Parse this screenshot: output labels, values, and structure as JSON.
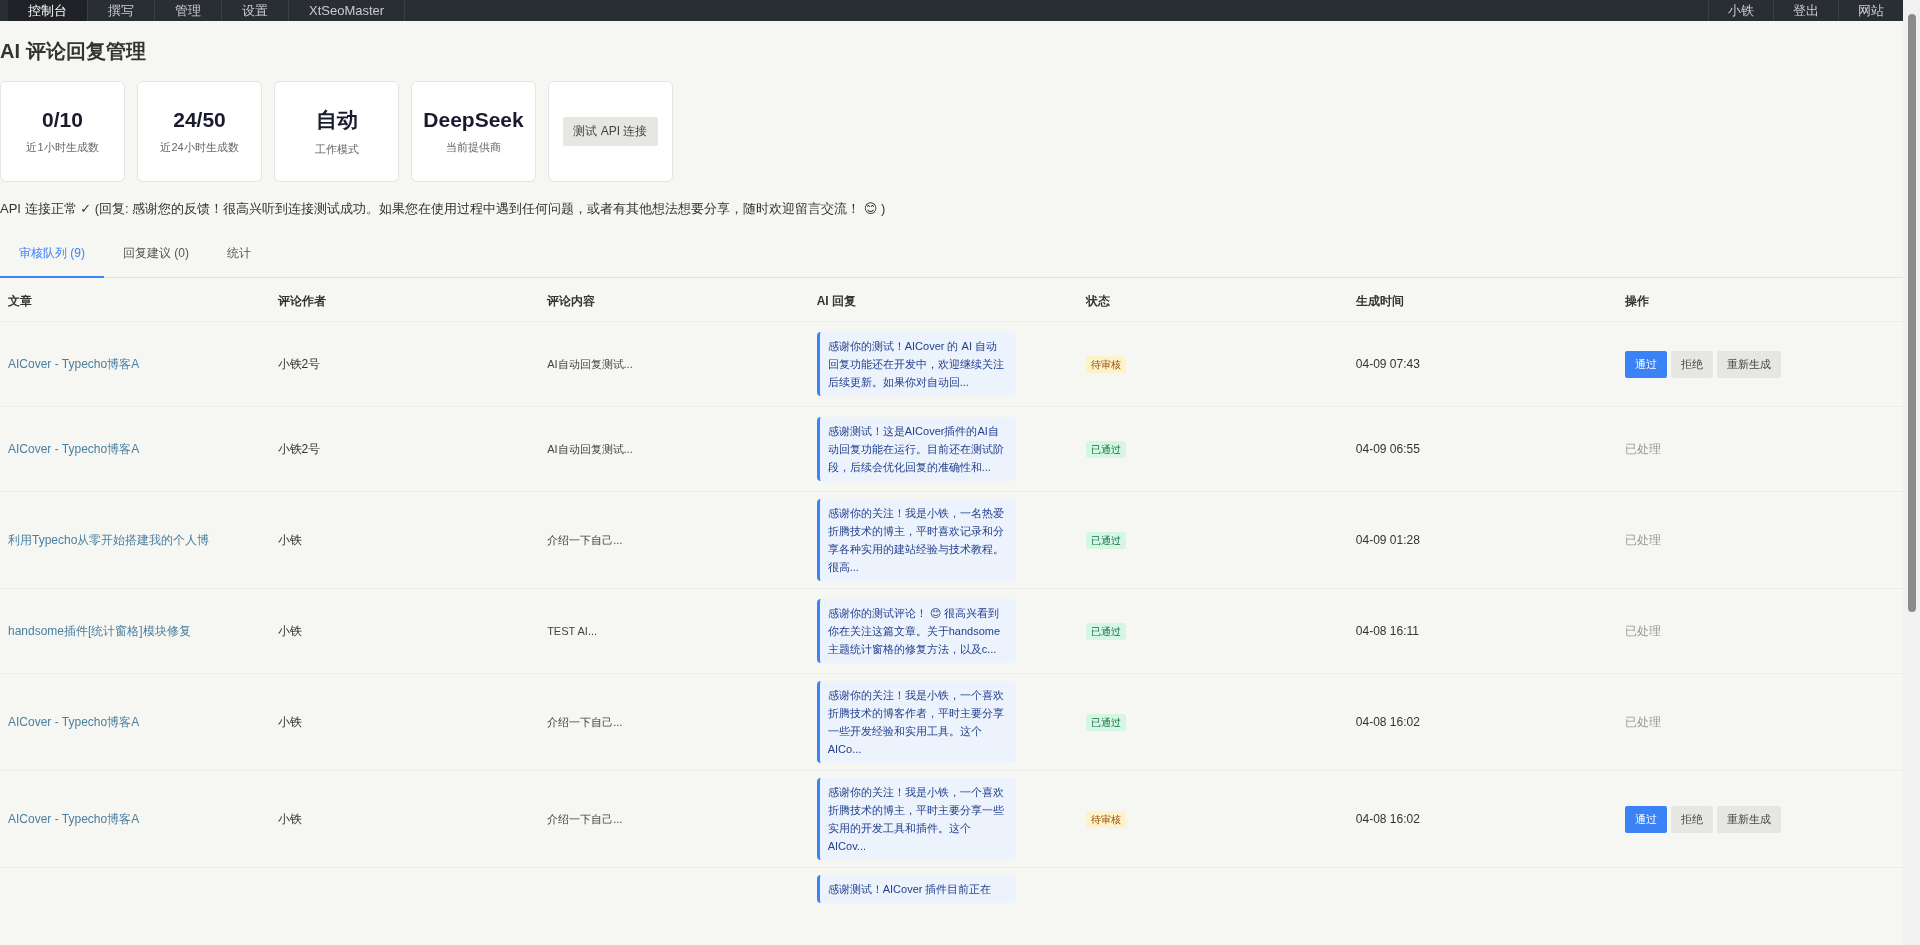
{
  "nav": {
    "left": [
      {
        "label": "控制台",
        "selected": true
      },
      {
        "label": "撰写",
        "selected": false
      },
      {
        "label": "管理",
        "selected": false
      },
      {
        "label": "设置",
        "selected": false
      },
      {
        "label": "XtSeoMaster",
        "selected": false
      }
    ],
    "right": [
      {
        "label": "小铁"
      },
      {
        "label": "登出"
      },
      {
        "label": "网站"
      }
    ]
  },
  "page_title": "AI 评论回复管理",
  "stats": [
    {
      "kind": "stat",
      "value": "0/10",
      "label": "近1小时生成数"
    },
    {
      "kind": "stat",
      "value": "24/50",
      "label": "近24小时生成数"
    },
    {
      "kind": "stat",
      "value": "自动",
      "label": "工作模式"
    },
    {
      "kind": "stat",
      "value": "DeepSeek",
      "label": "当前提供商"
    },
    {
      "kind": "action",
      "button": "测试 API 连接"
    }
  ],
  "api_status": "API 连接正常 ✓ (回复: 感谢您的反馈！很高兴听到连接测试成功。如果您在使用过程中遇到任何问题，或者有其他想法想要分享，随时欢迎留言交流！ 😊 )",
  "tabs": [
    {
      "label": "审核队列 (9)",
      "selected": true
    },
    {
      "label": "回复建议 (0)",
      "selected": false
    },
    {
      "label": "统计",
      "selected": false
    }
  ],
  "table": {
    "columns": [
      "文章",
      "评论作者",
      "评论内容",
      "AI 回复",
      "状态",
      "生成时间",
      "操作"
    ],
    "rows": [
      {
        "article": "AICover - Typecho博客A",
        "author": "小铁2号",
        "comment": "AI自动回复测试...",
        "ai_reply": "感谢你的测试！AICover 的 AI 自动回复功能还在开发中，欢迎继续关注后续更新。如果你对自动回...",
        "status": {
          "kind": "pending",
          "label": "待审核"
        },
        "time": "04-09 07:43",
        "actions": {
          "kind": "buttons",
          "approve": "通过",
          "reject": "拒绝",
          "regenerate": "重新生成"
        }
      },
      {
        "article": "AICover - Typecho博客A",
        "author": "小铁2号",
        "comment": "AI自动回复测试...",
        "ai_reply": "感谢测试！这是AICover插件的AI自动回复功能在运行。目前还在测试阶段，后续会优化回复的准确性和...",
        "status": {
          "kind": "approved",
          "label": "已通过"
        },
        "time": "04-09 06:55",
        "actions": {
          "kind": "done",
          "label": "已处理"
        }
      },
      {
        "article": "利用Typecho从零开始搭建我的个人博",
        "author": "小铁",
        "comment": "介绍一下自己...",
        "ai_reply": "感谢你的关注！我是小铁，一名热爱折腾技术的博主，平时喜欢记录和分享各种实用的建站经验与技术教程。很高...",
        "status": {
          "kind": "approved",
          "label": "已通过"
        },
        "time": "04-09 01:28",
        "actions": {
          "kind": "done",
          "label": "已处理"
        }
      },
      {
        "article": "handsome插件[统计窗格]模块修复",
        "author": "小铁",
        "comment": "TEST AI...",
        "ai_reply": "感谢你的测试评论！ 😊 很高兴看到你在关注这篇文章。关于handsome主题统计窗格的修复方法，以及c...",
        "status": {
          "kind": "approved",
          "label": "已通过"
        },
        "time": "04-08 16:11",
        "actions": {
          "kind": "done",
          "label": "已处理"
        }
      },
      {
        "article": "AICover - Typecho博客A",
        "author": "小铁",
        "comment": "介绍一下自己...",
        "ai_reply": "感谢你的关注！我是小铁，一个喜欢折腾技术的博客作者，平时主要分享一些开发经验和实用工具。这个AICo...",
        "status": {
          "kind": "approved",
          "label": "已通过"
        },
        "time": "04-08 16:02",
        "actions": {
          "kind": "done",
          "label": "已处理"
        }
      },
      {
        "article": "AICover - Typecho博客A",
        "author": "小铁",
        "comment": "介绍一下自己...",
        "ai_reply": "感谢你的关注！我是小铁，一个喜欢折腾技术的博主，平时主要分享一些实用的开发工具和插件。这个AICov...",
        "status": {
          "kind": "pending",
          "label": "待审核"
        },
        "time": "04-08 16:02",
        "actions": {
          "kind": "buttons",
          "approve": "通过",
          "reject": "拒绝",
          "regenerate": "重新生成"
        }
      },
      {
        "ai_reply": "感谢测试！AICover 插件目前正在"
      }
    ]
  }
}
